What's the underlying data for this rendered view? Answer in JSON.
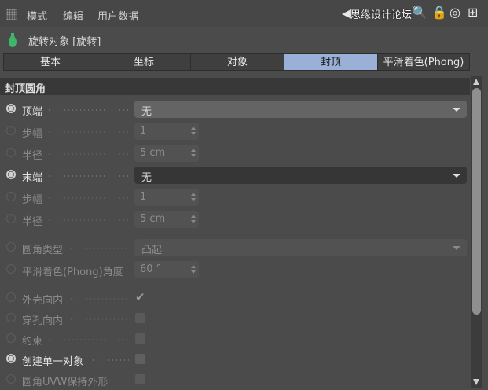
{
  "menu": {
    "items": [
      "模式",
      "编辑",
      "用户数据"
    ]
  },
  "watermark": "思缘设计论坛",
  "object": {
    "title": "旋转对象 [旋转]"
  },
  "tabs": [
    {
      "label": "基本",
      "active": false
    },
    {
      "label": "坐标",
      "active": false
    },
    {
      "label": "对象",
      "active": false
    },
    {
      "label": "封顶",
      "active": true
    },
    {
      "label": "平滑着色(Phong)",
      "active": false
    }
  ],
  "section": {
    "title": "封顶圆角"
  },
  "rows": {
    "top": {
      "label": "顶端",
      "value": "无"
    },
    "top_steps": {
      "label": "步幅",
      "value": "1"
    },
    "top_radius": {
      "label": "半径",
      "value": "5 cm"
    },
    "end": {
      "label": "末端",
      "value": "无"
    },
    "end_steps": {
      "label": "步幅",
      "value": "1"
    },
    "end_radius": {
      "label": "半径",
      "value": "5 cm"
    },
    "fillet_type": {
      "label": "圆角类型",
      "value": "凸起"
    },
    "phong_angle": {
      "label": "平滑着色(Phong)角度",
      "value": "60 °"
    },
    "hull_inward": {
      "label": "外壳向内",
      "checked": true
    },
    "hole_inward": {
      "label": "穿孔向内",
      "checked": false
    },
    "constrain": {
      "label": "约束",
      "checked": false
    },
    "single_object": {
      "label": "创建单一对象",
      "checked": false
    },
    "uvw_keep": {
      "label": "圆角UVW保持外形",
      "checked": false
    }
  },
  "colors": {
    "active_tab": "#9bb0d6",
    "panel": "#4b4b4b",
    "header": "#383838"
  }
}
